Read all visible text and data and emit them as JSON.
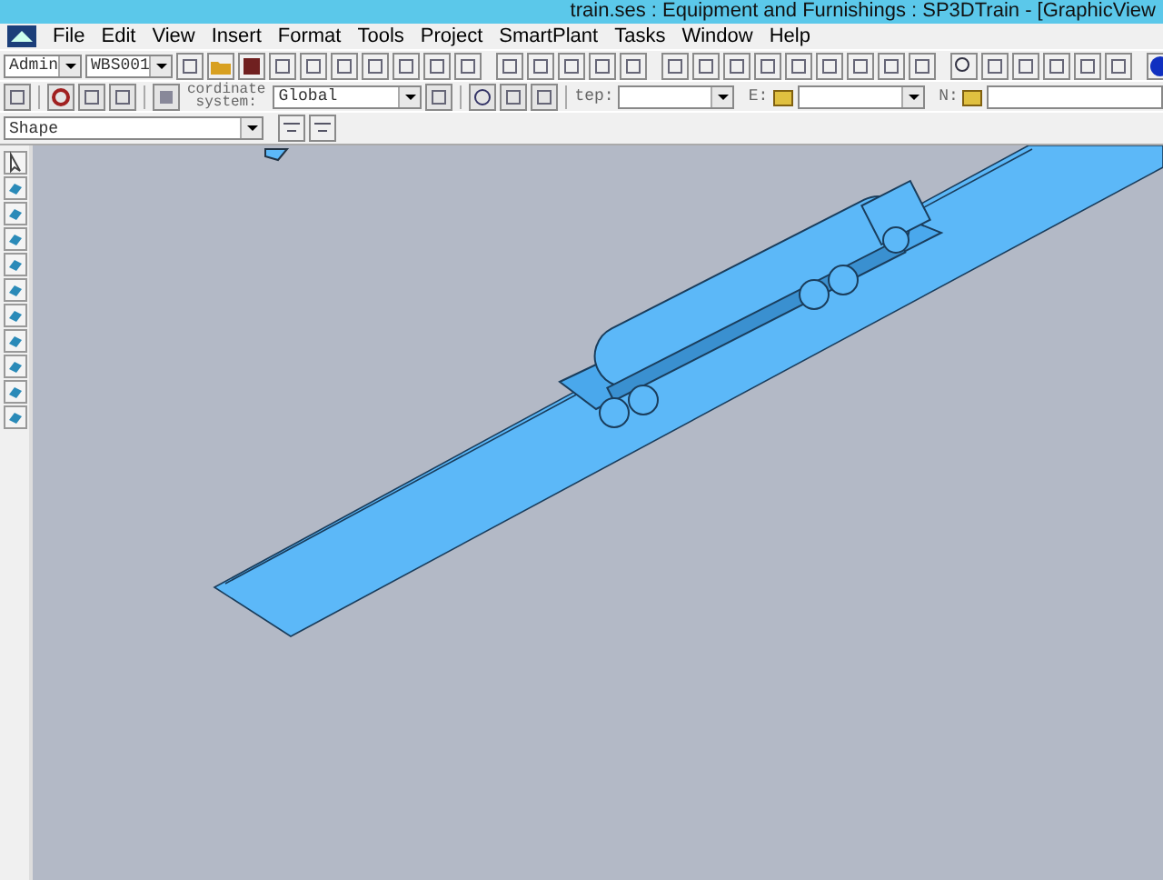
{
  "window": {
    "title": "train.ses : Equipment and Furnishings : SP3DTrain - [GraphicView"
  },
  "menu": [
    {
      "label": "File"
    },
    {
      "label": "Edit"
    },
    {
      "label": "View"
    },
    {
      "label": "Insert"
    },
    {
      "label": "Format"
    },
    {
      "label": "Tools"
    },
    {
      "label": "Project"
    },
    {
      "label": "SmartPlant"
    },
    {
      "label": "Tasks"
    },
    {
      "label": "Window"
    },
    {
      "label": "Help"
    }
  ],
  "toolbar": {
    "permission_group": "Admin",
    "wbs": "WBS001",
    "coordinate_label_1": "cordinate",
    "coordinate_label_2": "system:",
    "coordinate_system": "Global",
    "step_label": "tep:",
    "e_label": "E:",
    "n_label": "N:"
  },
  "filter": {
    "value": "Shape"
  }
}
